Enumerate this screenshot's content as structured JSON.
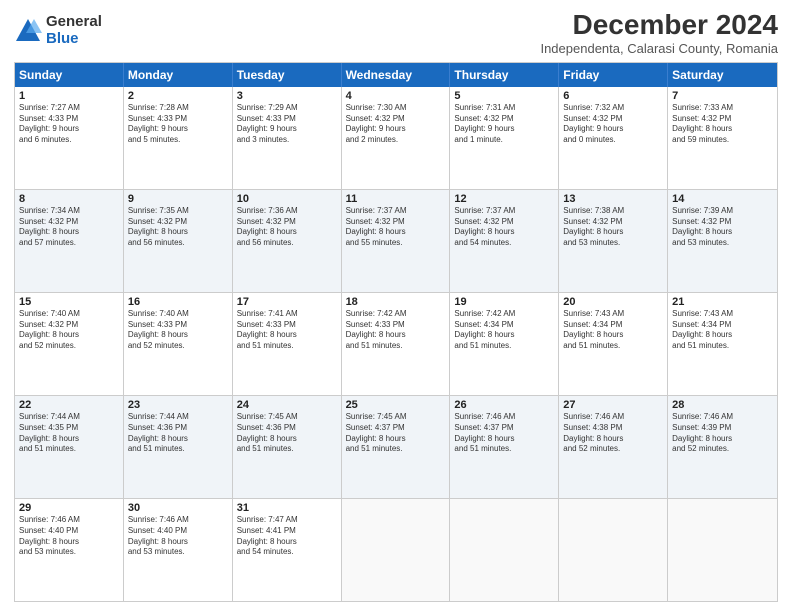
{
  "logo": {
    "general": "General",
    "blue": "Blue"
  },
  "title": "December 2024",
  "subtitle": "Independenta, Calarasi County, Romania",
  "header_days": [
    "Sunday",
    "Monday",
    "Tuesday",
    "Wednesday",
    "Thursday",
    "Friday",
    "Saturday"
  ],
  "weeks": [
    [
      {
        "day": "1",
        "lines": [
          "Sunrise: 7:27 AM",
          "Sunset: 4:33 PM",
          "Daylight: 9 hours",
          "and 6 minutes."
        ]
      },
      {
        "day": "2",
        "lines": [
          "Sunrise: 7:28 AM",
          "Sunset: 4:33 PM",
          "Daylight: 9 hours",
          "and 5 minutes."
        ]
      },
      {
        "day": "3",
        "lines": [
          "Sunrise: 7:29 AM",
          "Sunset: 4:33 PM",
          "Daylight: 9 hours",
          "and 3 minutes."
        ]
      },
      {
        "day": "4",
        "lines": [
          "Sunrise: 7:30 AM",
          "Sunset: 4:32 PM",
          "Daylight: 9 hours",
          "and 2 minutes."
        ]
      },
      {
        "day": "5",
        "lines": [
          "Sunrise: 7:31 AM",
          "Sunset: 4:32 PM",
          "Daylight: 9 hours",
          "and 1 minute."
        ]
      },
      {
        "day": "6",
        "lines": [
          "Sunrise: 7:32 AM",
          "Sunset: 4:32 PM",
          "Daylight: 9 hours",
          "and 0 minutes."
        ]
      },
      {
        "day": "7",
        "lines": [
          "Sunrise: 7:33 AM",
          "Sunset: 4:32 PM",
          "Daylight: 8 hours",
          "and 59 minutes."
        ]
      }
    ],
    [
      {
        "day": "8",
        "lines": [
          "Sunrise: 7:34 AM",
          "Sunset: 4:32 PM",
          "Daylight: 8 hours",
          "and 57 minutes."
        ]
      },
      {
        "day": "9",
        "lines": [
          "Sunrise: 7:35 AM",
          "Sunset: 4:32 PM",
          "Daylight: 8 hours",
          "and 56 minutes."
        ]
      },
      {
        "day": "10",
        "lines": [
          "Sunrise: 7:36 AM",
          "Sunset: 4:32 PM",
          "Daylight: 8 hours",
          "and 56 minutes."
        ]
      },
      {
        "day": "11",
        "lines": [
          "Sunrise: 7:37 AM",
          "Sunset: 4:32 PM",
          "Daylight: 8 hours",
          "and 55 minutes."
        ]
      },
      {
        "day": "12",
        "lines": [
          "Sunrise: 7:37 AM",
          "Sunset: 4:32 PM",
          "Daylight: 8 hours",
          "and 54 minutes."
        ]
      },
      {
        "day": "13",
        "lines": [
          "Sunrise: 7:38 AM",
          "Sunset: 4:32 PM",
          "Daylight: 8 hours",
          "and 53 minutes."
        ]
      },
      {
        "day": "14",
        "lines": [
          "Sunrise: 7:39 AM",
          "Sunset: 4:32 PM",
          "Daylight: 8 hours",
          "and 53 minutes."
        ]
      }
    ],
    [
      {
        "day": "15",
        "lines": [
          "Sunrise: 7:40 AM",
          "Sunset: 4:32 PM",
          "Daylight: 8 hours",
          "and 52 minutes."
        ]
      },
      {
        "day": "16",
        "lines": [
          "Sunrise: 7:40 AM",
          "Sunset: 4:33 PM",
          "Daylight: 8 hours",
          "and 52 minutes."
        ]
      },
      {
        "day": "17",
        "lines": [
          "Sunrise: 7:41 AM",
          "Sunset: 4:33 PM",
          "Daylight: 8 hours",
          "and 51 minutes."
        ]
      },
      {
        "day": "18",
        "lines": [
          "Sunrise: 7:42 AM",
          "Sunset: 4:33 PM",
          "Daylight: 8 hours",
          "and 51 minutes."
        ]
      },
      {
        "day": "19",
        "lines": [
          "Sunrise: 7:42 AM",
          "Sunset: 4:34 PM",
          "Daylight: 8 hours",
          "and 51 minutes."
        ]
      },
      {
        "day": "20",
        "lines": [
          "Sunrise: 7:43 AM",
          "Sunset: 4:34 PM",
          "Daylight: 8 hours",
          "and 51 minutes."
        ]
      },
      {
        "day": "21",
        "lines": [
          "Sunrise: 7:43 AM",
          "Sunset: 4:34 PM",
          "Daylight: 8 hours",
          "and 51 minutes."
        ]
      }
    ],
    [
      {
        "day": "22",
        "lines": [
          "Sunrise: 7:44 AM",
          "Sunset: 4:35 PM",
          "Daylight: 8 hours",
          "and 51 minutes."
        ]
      },
      {
        "day": "23",
        "lines": [
          "Sunrise: 7:44 AM",
          "Sunset: 4:36 PM",
          "Daylight: 8 hours",
          "and 51 minutes."
        ]
      },
      {
        "day": "24",
        "lines": [
          "Sunrise: 7:45 AM",
          "Sunset: 4:36 PM",
          "Daylight: 8 hours",
          "and 51 minutes."
        ]
      },
      {
        "day": "25",
        "lines": [
          "Sunrise: 7:45 AM",
          "Sunset: 4:37 PM",
          "Daylight: 8 hours",
          "and 51 minutes."
        ]
      },
      {
        "day": "26",
        "lines": [
          "Sunrise: 7:46 AM",
          "Sunset: 4:37 PM",
          "Daylight: 8 hours",
          "and 51 minutes."
        ]
      },
      {
        "day": "27",
        "lines": [
          "Sunrise: 7:46 AM",
          "Sunset: 4:38 PM",
          "Daylight: 8 hours",
          "and 52 minutes."
        ]
      },
      {
        "day": "28",
        "lines": [
          "Sunrise: 7:46 AM",
          "Sunset: 4:39 PM",
          "Daylight: 8 hours",
          "and 52 minutes."
        ]
      }
    ],
    [
      {
        "day": "29",
        "lines": [
          "Sunrise: 7:46 AM",
          "Sunset: 4:40 PM",
          "Daylight: 8 hours",
          "and 53 minutes."
        ]
      },
      {
        "day": "30",
        "lines": [
          "Sunrise: 7:46 AM",
          "Sunset: 4:40 PM",
          "Daylight: 8 hours",
          "and 53 minutes."
        ]
      },
      {
        "day": "31",
        "lines": [
          "Sunrise: 7:47 AM",
          "Sunset: 4:41 PM",
          "Daylight: 8 hours",
          "and 54 minutes."
        ]
      },
      {
        "day": "",
        "lines": []
      },
      {
        "day": "",
        "lines": []
      },
      {
        "day": "",
        "lines": []
      },
      {
        "day": "",
        "lines": []
      }
    ]
  ]
}
